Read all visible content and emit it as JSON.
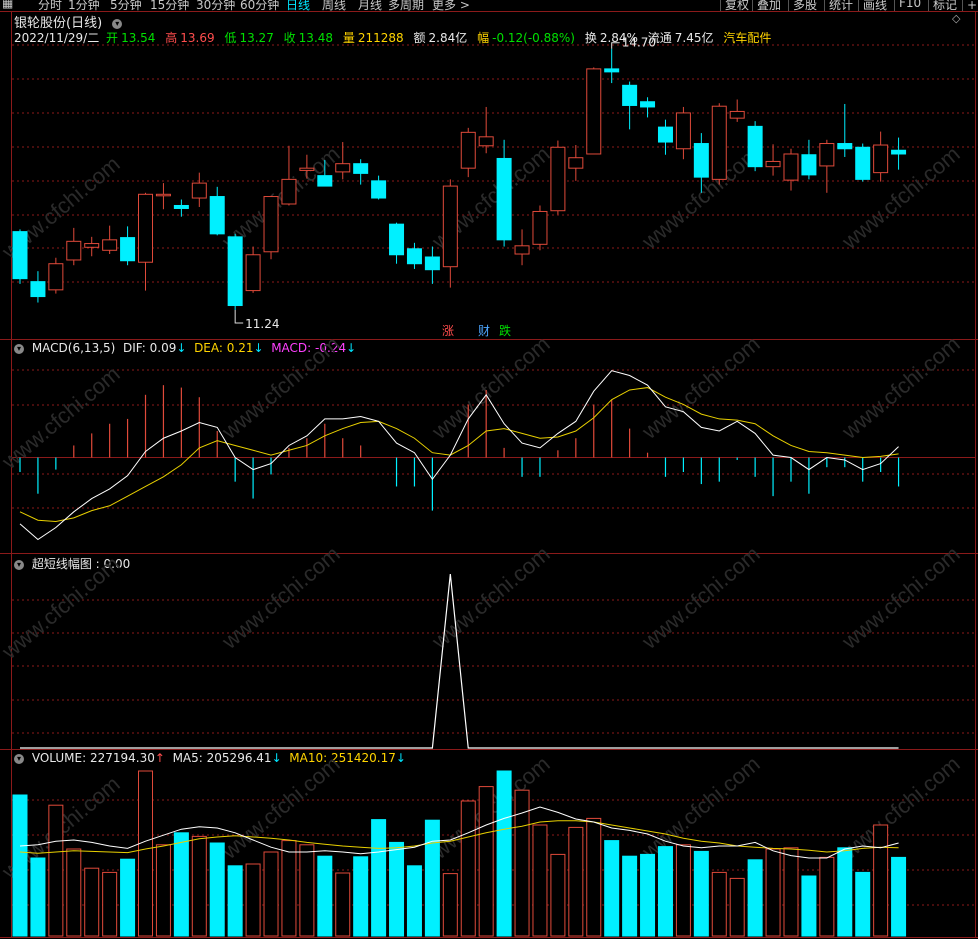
{
  "toolbar": {
    "left_icon": "grid-icon",
    "tabs": [
      "分时",
      "1分钟",
      "5分钟",
      "15分钟",
      "30分钟",
      "60分钟",
      "日线",
      "周线",
      "月线",
      "多周期",
      "更多 >"
    ],
    "active_tab": "日线",
    "right_buttons": [
      "复权",
      "叠加",
      "多股",
      "统计",
      "画线",
      "F10",
      "标记",
      "+自"
    ]
  },
  "stock": {
    "title": "银轮股份(日线)",
    "date": "2022/11/29/二",
    "open_label": "开",
    "open": "13.54",
    "high_label": "高",
    "high": "13.69",
    "low_label": "低",
    "low": "13.27",
    "close_label": "收",
    "close": "13.48",
    "volume_label": "量",
    "volume": "211288",
    "amount_label": "额",
    "amount": "2.84亿",
    "change_label": "幅",
    "change": "-0.12(-0.88%)",
    "turnover_label": "换",
    "turnover": "2.84%",
    "float_label": "流通",
    "float": "7.45亿",
    "sector": "汽车配件"
  },
  "annotations": {
    "high_price": "14.70",
    "low_price": "11.24",
    "markers": [
      {
        "text": "涨",
        "color": "#ff4d4d"
      },
      {
        "text": "财",
        "color": "#4da6ff"
      },
      {
        "text": "跌",
        "color": "#00e000"
      }
    ]
  },
  "macd": {
    "name": "MACD(6,13,5)",
    "dif_label": "DIF:",
    "dif": "0.09",
    "dea_label": "DEA:",
    "dea": "0.21",
    "macd_label": "MACD:",
    "macd": "-0.24",
    "arrow": "↓"
  },
  "ultra": {
    "name": "超短线幅图",
    "value": ": 0.00"
  },
  "volume": {
    "name_label": "VOLUME:",
    "value": "227194.30",
    "ma5_label": "MA5:",
    "ma5": "205296.41",
    "ma10_label": "MA10:",
    "ma10": "251420.17",
    "up_arrow": "↑",
    "down_arrow": "↓"
  },
  "watermark": "www.cfchi.com",
  "colors": {
    "up": "#e04a3a",
    "down": "#00f0ff",
    "grid": "#8b1a1a",
    "dif": "#ffffff",
    "dea": "#e8d000"
  },
  "chart_data": {
    "type": "candlestick",
    "candles": [
      {
        "o": 12.25,
        "c": 11.62,
        "h": 12.28,
        "l": 11.55
      },
      {
        "o": 11.58,
        "c": 11.38,
        "h": 11.72,
        "l": 11.3
      },
      {
        "o": 11.47,
        "c": 11.82,
        "h": 11.9,
        "l": 11.42
      },
      {
        "o": 11.87,
        "c": 12.12,
        "h": 12.3,
        "l": 11.8
      },
      {
        "o": 12.04,
        "c": 12.09,
        "h": 12.18,
        "l": 11.92
      },
      {
        "o": 12.0,
        "c": 12.14,
        "h": 12.33,
        "l": 11.95
      },
      {
        "o": 12.17,
        "c": 11.86,
        "h": 12.32,
        "l": 11.8
      },
      {
        "o": 11.84,
        "c": 12.75,
        "h": 12.77,
        "l": 11.46
      },
      {
        "o": 12.73,
        "c": 12.75,
        "h": 12.9,
        "l": 12.55
      },
      {
        "o": 12.6,
        "c": 12.56,
        "h": 12.68,
        "l": 12.45
      },
      {
        "o": 12.7,
        "c": 12.9,
        "h": 13.04,
        "l": 12.58
      },
      {
        "o": 12.72,
        "c": 12.22,
        "h": 12.85,
        "l": 12.2
      },
      {
        "o": 12.18,
        "c": 11.26,
        "h": 12.22,
        "l": 11.2
      },
      {
        "o": 11.46,
        "c": 11.94,
        "h": 12.05,
        "l": 11.43
      },
      {
        "o": 11.98,
        "c": 12.72,
        "h": 12.73,
        "l": 11.88
      },
      {
        "o": 12.62,
        "c": 12.95,
        "h": 13.4,
        "l": 12.6
      },
      {
        "o": 13.07,
        "c": 13.1,
        "h": 13.28,
        "l": 12.96
      },
      {
        "o": 13.0,
        "c": 12.86,
        "h": 13.21,
        "l": 12.95
      },
      {
        "o": 13.05,
        "c": 13.16,
        "h": 13.45,
        "l": 12.95
      },
      {
        "o": 13.16,
        "c": 13.03,
        "h": 13.22,
        "l": 12.88
      },
      {
        "o": 12.93,
        "c": 12.7,
        "h": 13.0,
        "l": 12.68
      },
      {
        "o": 12.35,
        "c": 11.94,
        "h": 12.37,
        "l": 11.82
      },
      {
        "o": 12.02,
        "c": 11.82,
        "h": 12.1,
        "l": 11.75
      },
      {
        "o": 11.91,
        "c": 11.74,
        "h": 12.05,
        "l": 11.55
      },
      {
        "o": 11.78,
        "c": 12.86,
        "h": 12.95,
        "l": 11.5
      },
      {
        "o": 13.1,
        "c": 13.58,
        "h": 13.64,
        "l": 12.98
      },
      {
        "o": 13.4,
        "c": 13.52,
        "h": 13.92,
        "l": 13.3
      },
      {
        "o": 13.23,
        "c": 12.14,
        "h": 13.48,
        "l": 12.05
      },
      {
        "o": 11.95,
        "c": 12.06,
        "h": 12.28,
        "l": 11.8
      },
      {
        "o": 12.08,
        "c": 12.52,
        "h": 12.6,
        "l": 12.0
      },
      {
        "o": 12.53,
        "c": 13.38,
        "h": 13.47,
        "l": 12.48
      },
      {
        "o": 13.1,
        "c": 13.24,
        "h": 13.41,
        "l": 12.93
      },
      {
        "o": 13.29,
        "c": 14.43,
        "h": 14.45,
        "l": 13.29
      },
      {
        "o": 14.43,
        "c": 14.39,
        "h": 14.7,
        "l": 14.24
      },
      {
        "o": 14.21,
        "c": 13.94,
        "h": 14.26,
        "l": 13.62
      },
      {
        "o": 13.99,
        "c": 13.92,
        "h": 14.05,
        "l": 13.78
      },
      {
        "o": 13.65,
        "c": 13.45,
        "h": 13.75,
        "l": 13.28
      },
      {
        "o": 13.36,
        "c": 13.84,
        "h": 13.92,
        "l": 13.22
      },
      {
        "o": 13.43,
        "c": 12.98,
        "h": 13.57,
        "l": 12.77
      },
      {
        "o": 12.95,
        "c": 13.93,
        "h": 13.97,
        "l": 12.88
      },
      {
        "o": 13.77,
        "c": 13.86,
        "h": 14.02,
        "l": 13.72
      },
      {
        "o": 13.66,
        "c": 13.12,
        "h": 13.73,
        "l": 13.06
      },
      {
        "o": 13.12,
        "c": 13.19,
        "h": 13.42,
        "l": 13.0
      },
      {
        "o": 12.94,
        "c": 13.29,
        "h": 13.36,
        "l": 12.8
      },
      {
        "o": 13.28,
        "c": 13.01,
        "h": 13.48,
        "l": 12.95
      },
      {
        "o": 13.13,
        "c": 13.43,
        "h": 13.48,
        "l": 12.77
      },
      {
        "o": 13.43,
        "c": 13.36,
        "h": 13.96,
        "l": 13.25
      },
      {
        "o": 13.38,
        "c": 12.95,
        "h": 13.43,
        "l": 12.92
      },
      {
        "o": 13.04,
        "c": 13.41,
        "h": 13.59,
        "l": 12.92
      },
      {
        "o": 13.34,
        "c": 13.29,
        "h": 13.51,
        "l": 13.08
      }
    ],
    "ultra_spike_index": 24,
    "volumes": [
      235,
      130,
      218,
      145,
      113,
      106,
      128,
      275,
      152,
      172,
      166,
      155,
      117,
      120,
      140,
      159,
      152,
      133,
      105,
      132,
      194,
      156,
      117,
      193,
      104,
      225,
      249,
      275,
      243,
      185,
      136,
      181,
      196,
      159,
      133,
      136,
      149,
      152,
      141,
      106,
      96,
      127,
      145,
      147,
      100,
      131,
      147,
      106,
      185,
      131
    ],
    "ma5": [
      150,
      152,
      158,
      160,
      156,
      150,
      146,
      158,
      168,
      178,
      182,
      180,
      172,
      160,
      148,
      140,
      140,
      142,
      140,
      137,
      140,
      144,
      148,
      158,
      160,
      172,
      185,
      196,
      205,
      215,
      206,
      195,
      190,
      180,
      176,
      170,
      158,
      150,
      147,
      150,
      150,
      156,
      142,
      134,
      130,
      130,
      145,
      150,
      147,
      155
    ],
    "ma10": [
      140,
      138,
      140,
      142,
      141,
      140,
      139,
      145,
      150,
      156,
      162,
      165,
      167,
      165,
      163,
      160,
      156,
      153,
      150,
      148,
      146,
      147,
      150,
      155,
      158,
      165,
      172,
      178,
      183,
      190,
      192,
      192,
      190,
      185,
      180,
      175,
      170,
      163,
      158,
      155,
      150,
      148,
      146,
      145,
      143,
      140,
      142,
      146,
      148,
      147
    ],
    "dif": [
      -0.55,
      -0.68,
      -0.58,
      -0.45,
      -0.34,
      -0.26,
      -0.15,
      0.05,
      0.16,
      0.22,
      0.29,
      0.25,
      0.0,
      -0.1,
      -0.05,
      0.1,
      0.18,
      0.32,
      0.32,
      0.34,
      0.3,
      0.12,
      0.04,
      -0.18,
      0.02,
      0.32,
      0.52,
      0.28,
      0.12,
      0.08,
      0.2,
      0.3,
      0.55,
      0.72,
      0.68,
      0.6,
      0.42,
      0.38,
      0.25,
      0.22,
      0.3,
      0.2,
      0.02,
      0.0,
      -0.1,
      0.0,
      -0.02,
      -0.1,
      -0.05,
      0.09
    ],
    "dea": [
      -0.45,
      -0.52,
      -0.53,
      -0.5,
      -0.44,
      -0.4,
      -0.32,
      -0.24,
      -0.16,
      -0.06,
      0.08,
      0.14,
      0.1,
      0.06,
      0.02,
      0.06,
      0.1,
      0.18,
      0.24,
      0.29,
      0.3,
      0.24,
      0.16,
      0.04,
      0.02,
      0.1,
      0.22,
      0.24,
      0.2,
      0.16,
      0.17,
      0.22,
      0.33,
      0.48,
      0.56,
      0.58,
      0.5,
      0.44,
      0.36,
      0.32,
      0.31,
      0.28,
      0.18,
      0.1,
      0.05,
      0.04,
      0.02,
      0.0,
      0.01,
      0.03
    ],
    "macd_hist": [
      -0.12,
      -0.3,
      -0.1,
      0.1,
      0.2,
      0.28,
      0.32,
      0.52,
      0.6,
      0.58,
      0.5,
      0.22,
      -0.2,
      -0.34,
      -0.14,
      0.08,
      0.16,
      0.28,
      0.16,
      0.1,
      0.0,
      -0.24,
      -0.24,
      -0.44,
      0.0,
      0.44,
      0.56,
      0.08,
      -0.16,
      -0.16,
      0.06,
      0.16,
      0.44,
      0.48,
      0.24,
      0.04,
      -0.16,
      -0.12,
      -0.22,
      -0.2,
      -0.02,
      -0.16,
      -0.32,
      -0.2,
      -0.3,
      -0.08,
      -0.08,
      -0.2,
      -0.12,
      -0.24
    ]
  }
}
